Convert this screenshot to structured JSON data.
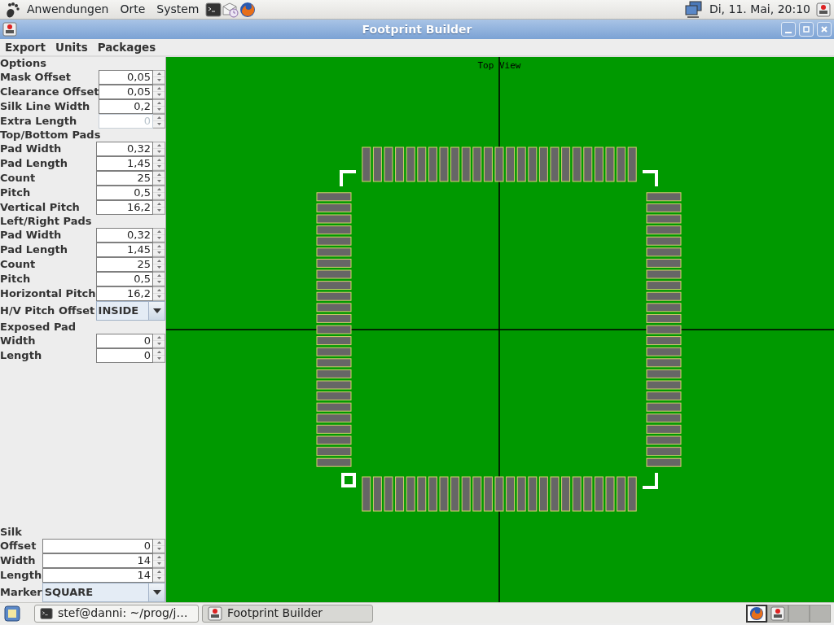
{
  "top_panel": {
    "menus": [
      "Anwendungen",
      "Orte",
      "System"
    ],
    "clock": "Di, 11. Mai, 20:10"
  },
  "window": {
    "title": "Footprint Builder"
  },
  "menu_bar": [
    "Export",
    "Units",
    "Packages"
  ],
  "sidebar": {
    "blocks": [
      [
        {
          "kind": "heading",
          "label": "Options"
        },
        {
          "kind": "spinner",
          "label": "Mask Offset",
          "value": "0,05",
          "disabled": false
        },
        {
          "kind": "spinner",
          "label": "Clearance Offset",
          "value": "0,05",
          "disabled": false
        },
        {
          "kind": "spinner",
          "label": "Silk Line Width",
          "value": "0,2",
          "disabled": false
        },
        {
          "kind": "spinner",
          "label": "Extra Length",
          "value": "0",
          "disabled": true
        }
      ],
      [
        {
          "kind": "heading",
          "label": "Top/Bottom Pads"
        },
        {
          "kind": "spinner",
          "label": "Pad Width",
          "value": "0,32",
          "disabled": false
        },
        {
          "kind": "spinner",
          "label": "Pad Length",
          "value": "1,45",
          "disabled": false
        },
        {
          "kind": "spinner",
          "label": "Count",
          "value": "25",
          "disabled": false
        },
        {
          "kind": "spinner",
          "label": "Pitch",
          "value": "0,5",
          "disabled": false
        },
        {
          "kind": "spinner",
          "label": "Vertical Pitch",
          "value": "16,2",
          "disabled": false
        },
        {
          "kind": "heading",
          "label": "Left/Right Pads"
        },
        {
          "kind": "spinner",
          "label": "Pad Width",
          "value": "0,32",
          "disabled": false
        },
        {
          "kind": "spinner",
          "label": "Pad Length",
          "value": "1,45",
          "disabled": false
        },
        {
          "kind": "spinner",
          "label": "Count",
          "value": "25",
          "disabled": false
        },
        {
          "kind": "spinner",
          "label": "Pitch",
          "value": "0,5",
          "disabled": false
        },
        {
          "kind": "spinner",
          "label": "Horizontal Pitch",
          "value": "16,2",
          "disabled": false
        },
        {
          "kind": "combo",
          "label": "H/V Pitch Offset",
          "value": "INSIDE"
        },
        {
          "kind": "heading",
          "label": "Exposed Pad"
        },
        {
          "kind": "spinner",
          "label": "Width",
          "value": "0",
          "disabled": false
        },
        {
          "kind": "spinner",
          "label": "Length",
          "value": "0",
          "disabled": false
        }
      ],
      [
        {
          "kind": "heading",
          "label": "Silk"
        },
        {
          "kind": "spinner",
          "label": "Offset",
          "value": "0",
          "disabled": false
        },
        {
          "kind": "spinner",
          "label": "Width",
          "value": "14",
          "disabled": false
        },
        {
          "kind": "spinner",
          "label": "Length",
          "value": "14",
          "disabled": false
        },
        {
          "kind": "combo",
          "label": "Marker",
          "value": "SQUARE"
        }
      ]
    ]
  },
  "canvas": {
    "label": "Top View"
  },
  "taskbar": {
    "tasks": [
      {
        "kind": "terminal",
        "label": "stef@danni: ~/prog/j…",
        "selected": false
      },
      {
        "kind": "app",
        "label": "Footprint Builder",
        "selected": true
      }
    ],
    "workspaces": [
      {
        "selected": true
      },
      {
        "selected": false
      },
      {
        "selected": false
      },
      {
        "selected": false
      }
    ]
  }
}
